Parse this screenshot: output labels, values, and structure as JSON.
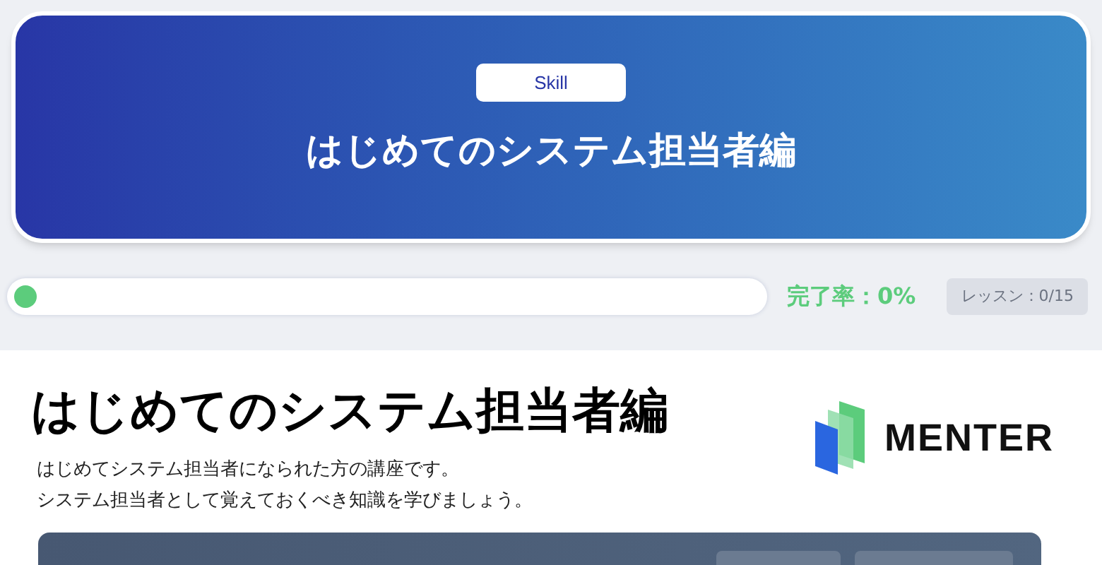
{
  "hero": {
    "badge": "Skill",
    "title": "はじめてのシステム担当者編"
  },
  "progress": {
    "level": 0,
    "rate": "完了率：0%",
    "lessons": "レッスン：0/15"
  },
  "course": {
    "title": "はじめてのシステム担当者編",
    "description": [
      "はじめてシステム担当者になられた方の講座です。",
      "システム担当者として覚えておくべき知識を学びましょう。"
    ],
    "logo": "MENTER"
  }
}
